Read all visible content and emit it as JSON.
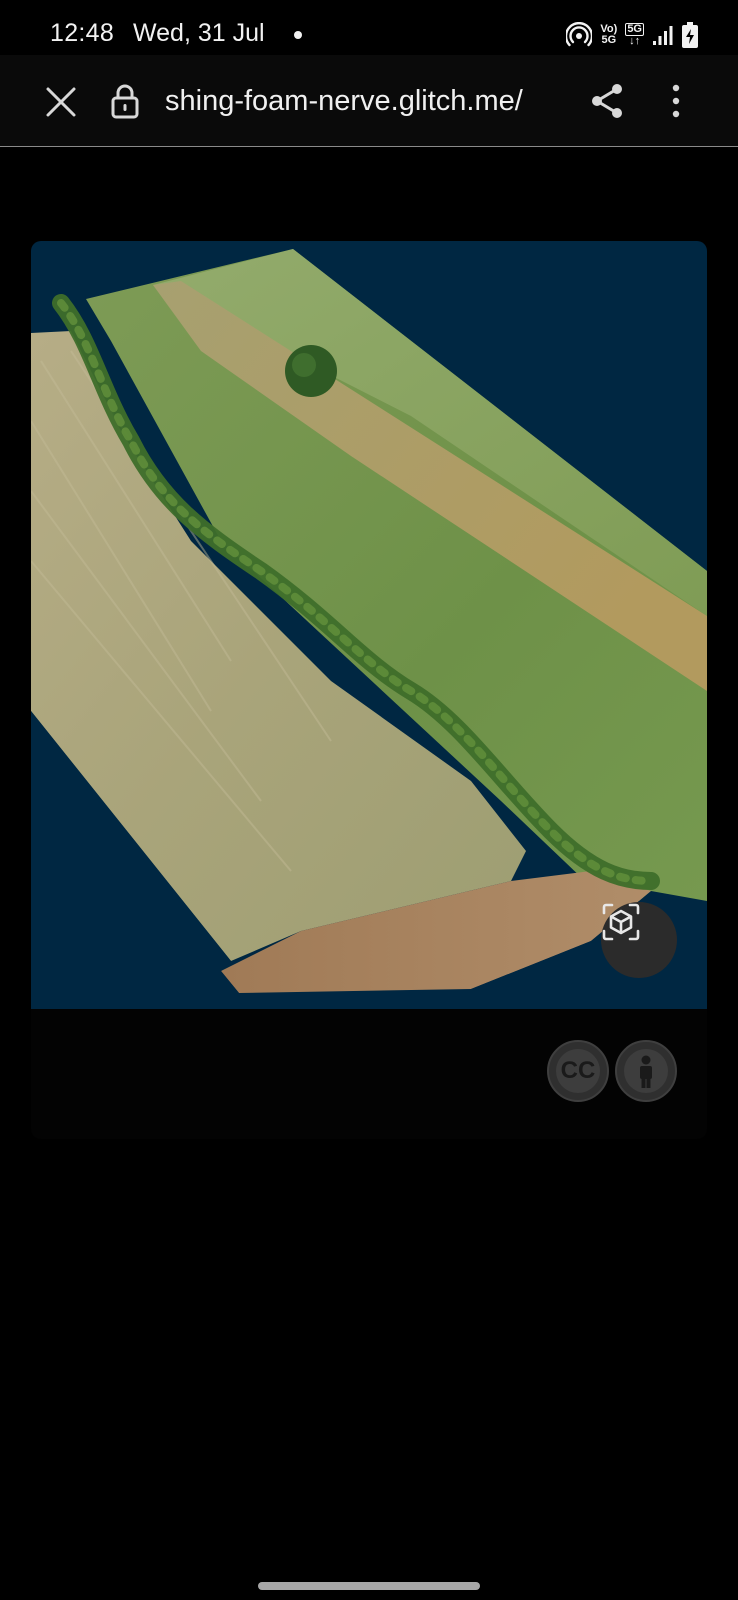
{
  "status_bar": {
    "time": "12:48",
    "date": "Wed, 31 Jul",
    "volte_top": "Vo)",
    "volte_bottom": "5G",
    "network_label": "5G"
  },
  "browser": {
    "url": "shing-foam-nerve.glitch.me/",
    "icons": [
      "close-icon",
      "lock-icon",
      "share-icon",
      "more-vert-icon"
    ]
  },
  "viewer": {
    "background_color": "#002742",
    "ar_button_icon": "view-in-ar-icon",
    "cc_label": "CC",
    "accessibility_icon": "person-icon"
  }
}
